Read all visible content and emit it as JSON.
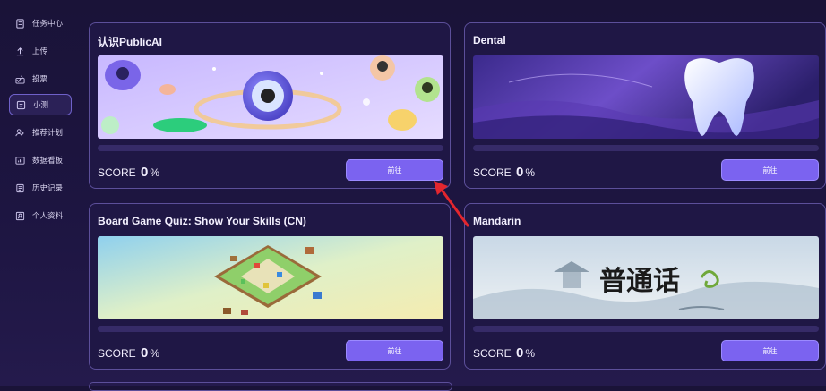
{
  "sidebar": {
    "items": [
      {
        "label": "任务中心",
        "icon": "task-icon",
        "active": false
      },
      {
        "label": "上传",
        "icon": "upload-icon",
        "active": false
      },
      {
        "label": "投票",
        "icon": "vote-icon",
        "active": false
      },
      {
        "label": "小测",
        "icon": "quiz-icon",
        "active": true
      },
      {
        "label": "推荐计划",
        "icon": "referral-icon",
        "active": false
      },
      {
        "label": "数据看板",
        "icon": "dashboard-icon",
        "active": false
      },
      {
        "label": "历史记录",
        "icon": "history-icon",
        "active": false
      },
      {
        "label": "个人资料",
        "icon": "profile-icon",
        "active": false
      }
    ]
  },
  "cards": [
    {
      "title": "认识PublicAI",
      "score_label": "SCORE",
      "score_value": "0",
      "score_unit": "%",
      "progress": 0,
      "button_label": "前往"
    },
    {
      "title": "Dental",
      "score_label": "SCORE",
      "score_value": "0",
      "score_unit": "%",
      "progress": 0,
      "button_label": "前往"
    },
    {
      "title": "Board Game Quiz: Show Your Skills (CN)",
      "score_label": "SCORE",
      "score_value": "0",
      "score_unit": "%",
      "progress": 0,
      "button_label": "前往"
    },
    {
      "title": "Mandarin",
      "image_text": "普通话",
      "score_label": "SCORE",
      "score_value": "0",
      "score_unit": "%",
      "progress": 0,
      "button_label": "前往"
    }
  ],
  "colors": {
    "accent": "#7b63f0",
    "background": "#1a1338",
    "annotation_arrow": "#e3262e"
  }
}
